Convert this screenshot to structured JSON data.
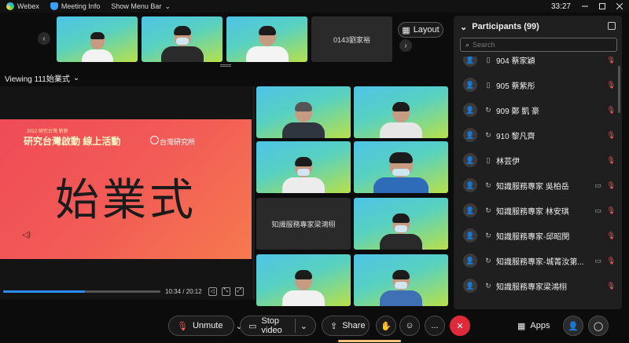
{
  "topbar": {
    "app_name": "Webex",
    "meeting_info": "Meeting Info",
    "show_menu_bar": "Show Menu Bar",
    "time": "33:27",
    "window_buttons": [
      "minimize",
      "maximize",
      "close"
    ]
  },
  "filmstrip": {
    "tiles": [
      {
        "type": "video"
      },
      {
        "type": "video"
      },
      {
        "type": "video"
      },
      {
        "type": "name",
        "name": "0143劉家裕"
      }
    ],
    "layout_label": "Layout"
  },
  "viewing": {
    "label": "Viewing 111始業式"
  },
  "share": {
    "slide_small_text": "2022 研究台灣 新新",
    "slide_event_text": "研究台灣啟動 線上活動",
    "slide_institute": "台灣研究所",
    "slide_big_text": "始業式",
    "player_time": "10:34 / 20:12",
    "progress_fraction": 0.52
  },
  "grid": {
    "tiles": [
      {
        "type": "video",
        "name": ""
      },
      {
        "type": "video",
        "name": ""
      },
      {
        "type": "video",
        "name": ""
      },
      {
        "type": "video",
        "name": ""
      },
      {
        "type": "name",
        "name": "知識服務專家梁鴻栩"
      },
      {
        "type": "video",
        "name": ""
      },
      {
        "type": "video",
        "name": ""
      },
      {
        "type": "video",
        "name": ""
      }
    ]
  },
  "participants": {
    "title": "Participants (99)",
    "search_placeholder": "Search",
    "rows": [
      {
        "name": "904 蔡家穎",
        "device": "phone",
        "video": false,
        "partial": true
      },
      {
        "name": "905 蔡紫彤",
        "device": "phone",
        "video": false
      },
      {
        "name": "909 鄭 凱 豪",
        "device": "sync",
        "video": false
      },
      {
        "name": "910 黎凡齊",
        "device": "sync",
        "video": false
      },
      {
        "name": "林芸伊",
        "device": "phone",
        "video": false
      },
      {
        "name": "知識服務專家 吳柏岳",
        "device": "sync",
        "video": true
      },
      {
        "name": "知識服務專家 林安琪",
        "device": "sync",
        "video": true
      },
      {
        "name": "知識服務專家-邱昭閔",
        "device": "sync",
        "video": false
      },
      {
        "name": "知識服務專家-城菁汝第...",
        "device": "sync",
        "video": true
      },
      {
        "name": "知識服務專家梁鴻栩",
        "device": "sync",
        "video": false
      }
    ]
  },
  "controls": {
    "unmute": "Unmute",
    "stop_video": "Stop video",
    "share": "Share",
    "more": "...",
    "apps": "Apps"
  },
  "colors": {
    "accent_blue": "#2d8cff",
    "mute_red": "#ff5c5c",
    "end_call_red": "#e02a3a",
    "slide_red": "#f25b56"
  }
}
